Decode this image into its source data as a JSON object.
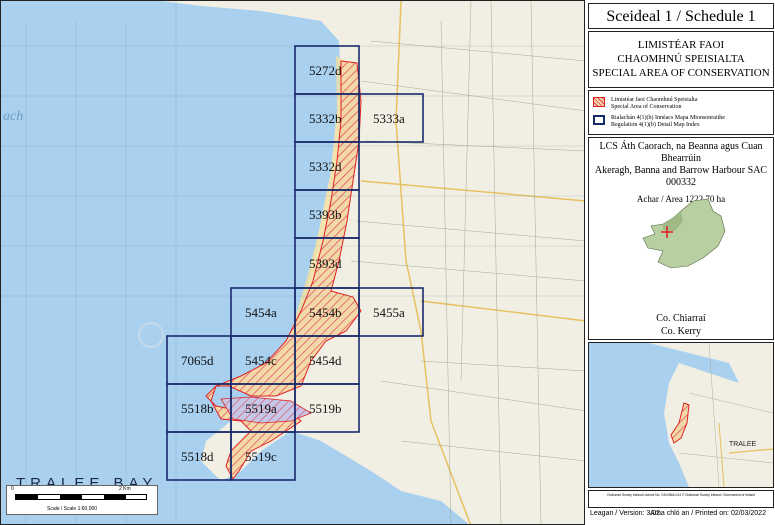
{
  "title": "Sceideal 1 / Schedule 1",
  "sac_heading": {
    "line1": "LIMISTÉAR FAOI",
    "line2": "CHAOMHNÚ SPEISIALTA",
    "line3": "SPECIAL AREA OF CONSERVATION"
  },
  "legend": {
    "sac_irish": "Limistéar faoi Chaomhnú Speisialta",
    "sac_english": "Special Area of Conservation",
    "index_irish": "Rialachán 4(1)(b) Innéacs Mapa Mionsonraithe",
    "index_english": "Regulation 4(1)(b) Detail Map Index",
    "sac_color": "#e03030",
    "index_color": "#1a2a6c"
  },
  "site": {
    "name_irish": "LCS Áth Caorach, na Beanna agus Cuan Bhearrúin",
    "name_english": "Akeragh, Banna and Barrow Harbour SAC",
    "code": "000332",
    "area": "Achar / Area 1222.70 ha"
  },
  "county": {
    "irish": "Co. Chiarraí",
    "english": "Co. Kerry"
  },
  "tiles": [
    {
      "id": "5272d"
    },
    {
      "id": "5332b"
    },
    {
      "id": "5333a"
    },
    {
      "id": "5332d"
    },
    {
      "id": "5393b"
    },
    {
      "id": "5393d"
    },
    {
      "id": "5454a"
    },
    {
      "id": "5454b"
    },
    {
      "id": "5455a"
    },
    {
      "id": "7065d"
    },
    {
      "id": "5454c"
    },
    {
      "id": "5454d"
    },
    {
      "id": "5518b"
    },
    {
      "id": "5519a"
    },
    {
      "id": "5519b"
    },
    {
      "id": "5518d"
    },
    {
      "id": "5519c"
    }
  ],
  "map_labels": {
    "bay": "TRALEE BAY",
    "sea_fragment": "ach",
    "scale_start": "0",
    "scale_end": "2 Km",
    "scale_ratio": "Scale / Scale 1:60,000"
  },
  "inset_labels": {
    "tralee": "TRALEE"
  },
  "credits": "Ordnance Survey Ireland Licence No. OSi-NMA-014 © Ordnance Survey Ireland / Government of Ireland",
  "footer": {
    "version": "Leagan / Version: 3.02",
    "printed": "Arna chló an / Printed on: 02/03/2022"
  },
  "colors": {
    "sea": "#9ec8ea",
    "land": "#f2f0e6",
    "sac_hatch": "#e8a15a",
    "index_border": "#1a2a6c"
  }
}
